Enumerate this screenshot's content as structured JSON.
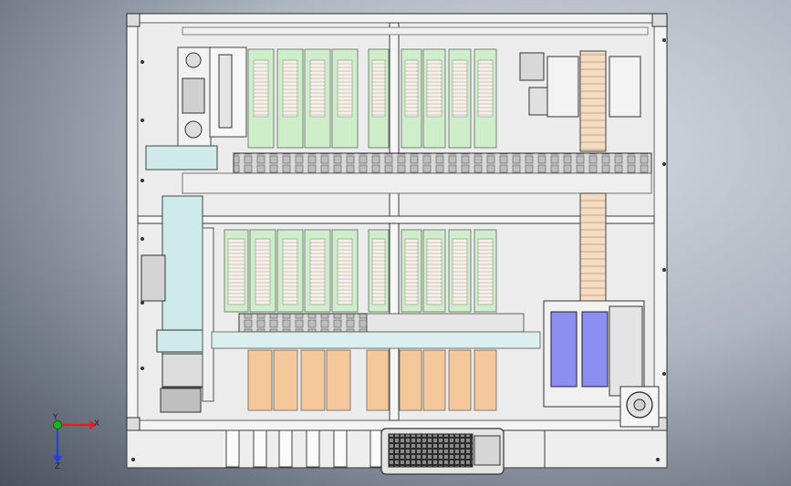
{
  "view": {
    "background_top": "#d6dbe2",
    "background_bottom": "#4a525d",
    "frame_color": "#e9e9e9",
    "line_color": "#3a3a3a",
    "conveyor_green": "#cdeec9",
    "pallet_orange": "#f4c89a",
    "pallet_blue": "#8c8ff0",
    "panel_cyan": "#cfeaea"
  },
  "triad": {
    "x_label": "X",
    "y_label": "Y",
    "z_label": "Z",
    "x_color": "#e02020",
    "y_color": "#20b020",
    "z_color": "#2040e0"
  }
}
